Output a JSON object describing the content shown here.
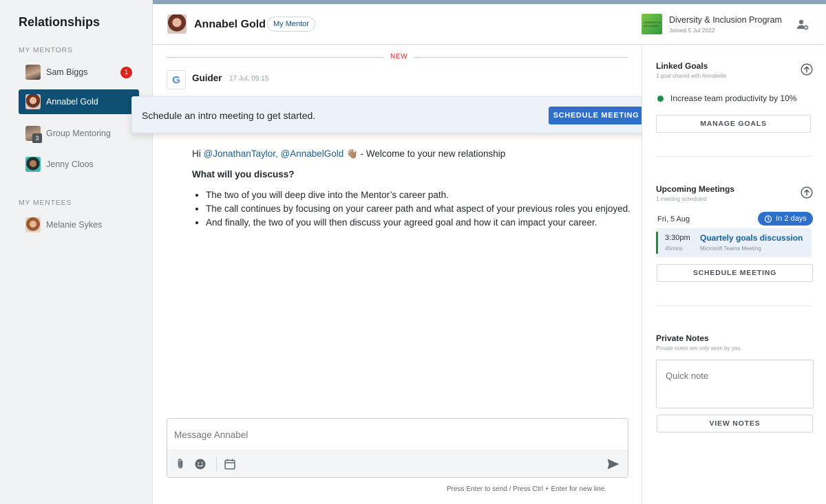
{
  "sidebar": {
    "title": "Relationships",
    "mentors_label": "MY MENTORS",
    "mentees_label": "MY MENTEES",
    "mentors": [
      {
        "label": "Sam Biggs",
        "badge": "1"
      },
      {
        "label": "Annabel Gold"
      },
      {
        "label": "Group Mentoring",
        "count": "3"
      },
      {
        "label": "Jenny Cloos"
      }
    ],
    "mentees": [
      {
        "label": "Melanie Sykes"
      }
    ]
  },
  "header": {
    "name": "Annabel Gold",
    "role_pill": "My Mentor",
    "program_title": "Diversity & Inclusion Program",
    "program_joined": "Joined 5 Jul 2022",
    "program_logo_text": "DIVERSITY & INCLUSION"
  },
  "chat": {
    "new_label": "NEW",
    "sender": "Guider",
    "sender_logo": "G",
    "timestamp": "17 Jul, 09:15",
    "greeting_prefix": "Hi ",
    "mention_1": "@JonathanTaylor,",
    "mention_2": "@AnnabelGold",
    "emoji": "👋🏽",
    "greeting_suffix": " - Welcome to your new relationship",
    "heading": "What will you discuss?",
    "bullets": [
      "The two of you will deep dive into the Mentor’s career path.",
      "The call continues by focusing on your career path and what aspect of your previous roles you enjoyed.",
      "And finally, the two of you will then discuss your agreed goal and how it can impact your career."
    ]
  },
  "toast": {
    "text": "Schedule an intro meeting to get started.",
    "button": "SCHEDULE MEETING"
  },
  "composer": {
    "placeholder": "Message Annabel",
    "hint": "Press Enter to send / Press Ctrl + Enter for new line."
  },
  "right_panel": {
    "goals": {
      "title": "Linked Goals",
      "subtitle": "1 goal shared with Annabelle",
      "goal": "Increase team productivity by 10%",
      "goal_color": "#1e8a4b",
      "button": "MANAGE GOALS"
    },
    "meetings": {
      "title": "Upcoming Meetings",
      "subtitle": "1 meeting scheduled",
      "date": "Fri, 5 Aug",
      "countdown": "In 2 days",
      "time": "3:30pm",
      "duration": "45mins",
      "meeting_title": "Quartely goals discussion",
      "meeting_platform": "Microsoft Teams Meeting",
      "button": "SCHEDULE MEETING"
    },
    "notes": {
      "title": "Private Notes",
      "subtitle": "Private notes are only seen by you",
      "placeholder": "Quick note",
      "button": "VIEW NOTES"
    }
  },
  "colors": {
    "accent": "#2e6fcb",
    "active_nav": "#0f4f73",
    "alert": "#d8251e"
  }
}
